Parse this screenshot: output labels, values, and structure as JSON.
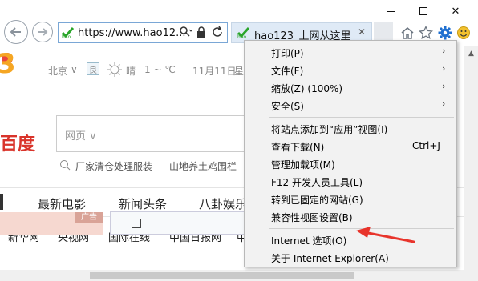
{
  "window": {
    "min": "—",
    "max": "☐",
    "close": "✕"
  },
  "address_bar": {
    "url": "https://www.hao12..."
  },
  "tab": {
    "title": "hao123_上网从这里...",
    "close": "✕"
  },
  "toolbar_icons": [
    "home-icon",
    "favorites-star-icon",
    "settings-gear-icon",
    "smiley-feedback-icon"
  ],
  "page": {
    "weather": {
      "city": "北京",
      "badge": "良",
      "cond": "晴",
      "temp": "1 ~ ℃",
      "date": "11月11日",
      "extra": "星"
    },
    "search": {
      "engine_logo": "百度",
      "type_selector": "网页"
    },
    "hot_searches": [
      "厂家清仓处理服装",
      "山地养土鸡围栏"
    ],
    "categories": [
      "最新电影",
      "新闻头条",
      "八卦娱乐"
    ],
    "sites": [
      "新华网",
      "央视网",
      "国际在线",
      "中国日报网",
      "中"
    ],
    "ad_label": "广告"
  },
  "context_menu": {
    "items": [
      {
        "label": "打印(P)",
        "submenu": true
      },
      {
        "label": "文件(F)",
        "submenu": true
      },
      {
        "label": "缩放(Z) (100%)",
        "submenu": true
      },
      {
        "label": "安全(S)",
        "submenu": true
      },
      {
        "label": "将站点添加到“应用”视图(I)"
      },
      {
        "label": "查看下载(N)",
        "shortcut": "Ctrl+J"
      },
      {
        "label": "管理加载项(M)"
      },
      {
        "label": "F12 开发人员工具(L)"
      },
      {
        "label": "转到已固定的网站(G)"
      },
      {
        "label": "兼容性视图设置(B)"
      },
      {
        "label": "Internet 选项(O)"
      },
      {
        "label": "关于 Internet Explorer(A)"
      }
    ],
    "submenu_arrow": "›"
  },
  "colors": {
    "accent": "#1e6fd0",
    "annotation": "#e8342b",
    "menu_bg": "#f2f2f2"
  }
}
